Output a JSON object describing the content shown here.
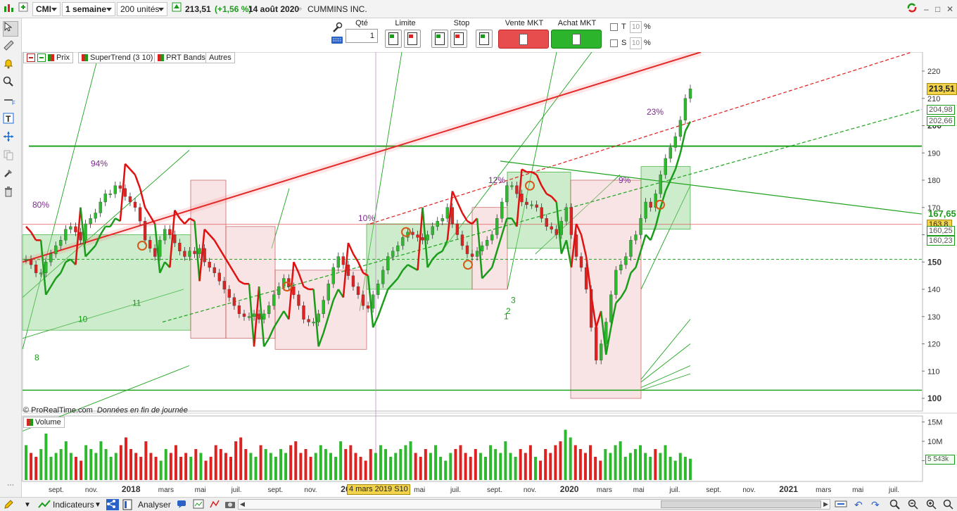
{
  "toolbar": {
    "symbol": "CMI",
    "period": "1 semaine",
    "units": "200 unités",
    "price": "213,51",
    "change": "(+1,56 %)",
    "date": "14 août 2020",
    "instrument": "CUMMINS INC.",
    "window_controls": [
      "–",
      "□",
      "✕"
    ]
  },
  "orders": {
    "qty_label": "Qté",
    "qty_value": "1",
    "limit_label": "Limite",
    "stop_label": "Stop",
    "sell_label": "Vente MKT",
    "buy_label": "Achat MKT",
    "t_label": "T",
    "s_label": "S",
    "pct_value": "10",
    "pct_sign": "%"
  },
  "legend": {
    "prix": "Prix",
    "supertrend": "SuperTrend (3 10)",
    "bands": "PRT Bands",
    "autres": "Autres",
    "volume": "Volume"
  },
  "chart_data": {
    "type": "candlestick",
    "instrument": "CMI",
    "period": "1 semaine",
    "last_price": 213.51,
    "price_axis": {
      "min": 100,
      "max": 220,
      "ticks": [
        "220",
        "210",
        "200",
        "190",
        "180",
        "170",
        "160",
        "150",
        "140",
        "130",
        "120",
        "110",
        "100"
      ]
    },
    "right_labels": {
      "last": "213,51",
      "a": "204,98",
      "b": "202,66",
      "green": "167,65",
      "yellow": "163,8",
      "c": "160,25",
      "d": "160,23"
    },
    "x_labels": [
      "sept.",
      "nov.",
      "2018",
      "mars",
      "mai",
      "juil.",
      "sept.",
      "nov.",
      "201",
      "mars",
      "mai",
      "juil.",
      "sept.",
      "nov.",
      "2020",
      "mars",
      "mai",
      "juil.",
      "sept.",
      "nov.",
      "2021",
      "mars",
      "mai",
      "juil."
    ],
    "crosshair_label": "4 mars 2019 S10",
    "annotations": [
      "80%",
      "94%",
      "10%",
      "12%",
      "9%",
      "23%"
    ],
    "fan_labels": [
      "8",
      "10",
      "11",
      "3",
      "2",
      "1"
    ],
    "watermark": "© ProRealTime.com",
    "watermark_note": "Données en fin de journée",
    "volume_axis": [
      "15M",
      "10M",
      "5M"
    ],
    "volume_last": "5 543k",
    "close_series": [
      151,
      149,
      146,
      146,
      150,
      153,
      156,
      158,
      162,
      163,
      161,
      158,
      164,
      166,
      168,
      172,
      175,
      175,
      178,
      177,
      174,
      172,
      170,
      165,
      158,
      155,
      152,
      158,
      162,
      160,
      157,
      154,
      152,
      154,
      153,
      155,
      150,
      148,
      146,
      143,
      140,
      137,
      134,
      131,
      130,
      130,
      131,
      129,
      131,
      134,
      138,
      141,
      144,
      141,
      138,
      134,
      129,
      128,
      128,
      131,
      136,
      142,
      148,
      152,
      149,
      145,
      141,
      138,
      134,
      133,
      138,
      142,
      147,
      152,
      154,
      156,
      159,
      161,
      160,
      159,
      158,
      160,
      163,
      165,
      166,
      170,
      164,
      160,
      156,
      153,
      152,
      154,
      156,
      158,
      160,
      166,
      172,
      178,
      178,
      175,
      172,
      171,
      171,
      170,
      166,
      163,
      162,
      160,
      165,
      170,
      160,
      152,
      148,
      140,
      126,
      114,
      120,
      128,
      138,
      147,
      149,
      152,
      158,
      160,
      166,
      172,
      170,
      175,
      182,
      188,
      192,
      196,
      202,
      210,
      213.51
    ],
    "volume_series": [
      9,
      7,
      6,
      8,
      12,
      6,
      7,
      8,
      10,
      7,
      6,
      5,
      9,
      8,
      7,
      10,
      8,
      6,
      7,
      9,
      11,
      8,
      7,
      6,
      10,
      7,
      6,
      5,
      8,
      7,
      9,
      6,
      7,
      6,
      8,
      7,
      5,
      6,
      9,
      8,
      7,
      6,
      10,
      11,
      8,
      7,
      6,
      9,
      8,
      7,
      6,
      8,
      7,
      9,
      10,
      7,
      8,
      6,
      7,
      9,
      8,
      7,
      6,
      10,
      8,
      9,
      7,
      6,
      5,
      8,
      7,
      9,
      8,
      6,
      7,
      8,
      9,
      10,
      7,
      6,
      8,
      7,
      9,
      6,
      5,
      7,
      8,
      9,
      7,
      6,
      8,
      7,
      6,
      9,
      8,
      7,
      10,
      7,
      6,
      8,
      7,
      9,
      6,
      5,
      8,
      7,
      9,
      10,
      13,
      11,
      9,
      8,
      7,
      9,
      6,
      5,
      8,
      7,
      9,
      10,
      6,
      7,
      8,
      9,
      7,
      6,
      8,
      7,
      9,
      6,
      5,
      7,
      6,
      5.5
    ]
  }
}
